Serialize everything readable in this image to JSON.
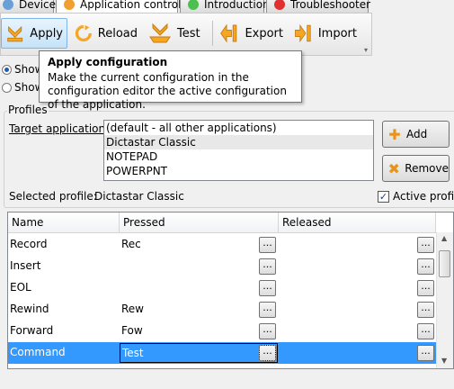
{
  "tabs": [
    {
      "label": "Device",
      "color": "#6aa0d8"
    },
    {
      "label": "Application control",
      "color": "#f0a030"
    },
    {
      "label": "Introduction",
      "color": "#4cc04c"
    },
    {
      "label": "Troubleshooter",
      "color": "#e03030"
    }
  ],
  "toolbar": {
    "apply": "Apply",
    "reload": "Reload",
    "test": "Test",
    "export": "Export",
    "import": "Import"
  },
  "tooltip": {
    "title": "Apply configuration",
    "body": "Make the current configuration in the configuration editor the active configuration of the application."
  },
  "radios": [
    {
      "label": "Show",
      "checked": true
    },
    {
      "label": "Show",
      "checked": false
    }
  ],
  "profiles": {
    "legend": "Profiles",
    "target_label": "Target application",
    "applications": [
      "(default - all other applications)",
      "Dictastar Classic",
      "NOTEPAD",
      "POWERPNT"
    ],
    "selected_index": 1,
    "add_button": "Add",
    "remove_button": "Remove",
    "selected_profile_label": "Selected profile:",
    "selected_profile_value": "Dictastar Classic",
    "active_profile_label": "Active profile",
    "active_profile_checked": true
  },
  "grid": {
    "columns": [
      "Name",
      "Pressed",
      "Released"
    ],
    "ellipsis": "...",
    "rows": [
      {
        "name": "Record",
        "pressed": "Rec",
        "released": ""
      },
      {
        "name": "Insert",
        "pressed": "",
        "released": ""
      },
      {
        "name": "EOL",
        "pressed": "",
        "released": ""
      },
      {
        "name": "Rewind",
        "pressed": "Rew",
        "released": ""
      },
      {
        "name": "Forward",
        "pressed": "Fow",
        "released": ""
      },
      {
        "name": "Command",
        "pressed": "Test",
        "released": ""
      }
    ],
    "selected_index": 5
  },
  "colors": {
    "accent": "#3399ff",
    "toolbar_icon": "#f5a623"
  }
}
